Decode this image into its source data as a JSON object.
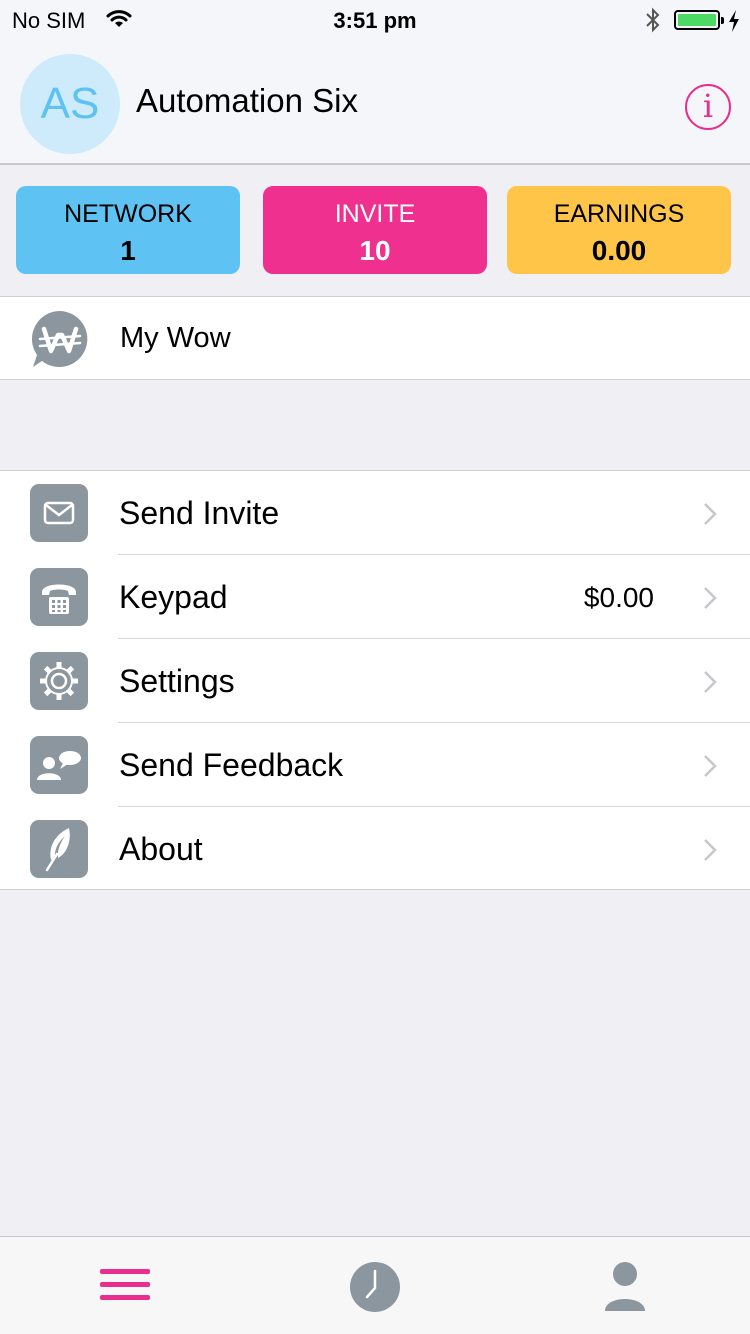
{
  "status_bar": {
    "carrier": "No SIM",
    "time": "3:51 pm",
    "battery_level": 1.0
  },
  "profile": {
    "initials": "AS",
    "name": "Automation Six",
    "info_icon": "info-icon"
  },
  "stats": {
    "network": {
      "label": "NETWORK",
      "value": "1"
    },
    "invite": {
      "label": "INVITE",
      "value": "10"
    },
    "earnings": {
      "label": "EARNINGS",
      "value": "0.00"
    }
  },
  "my_wow": {
    "label": "My Wow",
    "icon": "wow-logo-icon"
  },
  "menu": [
    {
      "label": "Send Invite",
      "value": "",
      "icon": "envelope-icon"
    },
    {
      "label": "Keypad",
      "value": "$0.00",
      "icon": "keypad-phone-icon"
    },
    {
      "label": "Settings",
      "value": "",
      "icon": "gear-icon"
    },
    {
      "label": "Send Feedback",
      "value": "",
      "icon": "feedback-icon"
    },
    {
      "label": "About",
      "value": "",
      "icon": "feather-icon"
    }
  ],
  "tab_bar": [
    {
      "name": "menu",
      "icon": "hamburger-icon",
      "active": true
    },
    {
      "name": "history",
      "icon": "clock-icon",
      "active": false
    },
    {
      "name": "contacts",
      "icon": "person-icon",
      "active": false
    }
  ],
  "colors": {
    "accent": "#ea2e8e",
    "network": "#5ec3f2",
    "invite": "#f0308e",
    "earnings": "#ffc548",
    "icon_tile": "#8c969e",
    "battery": "#4cd964"
  }
}
